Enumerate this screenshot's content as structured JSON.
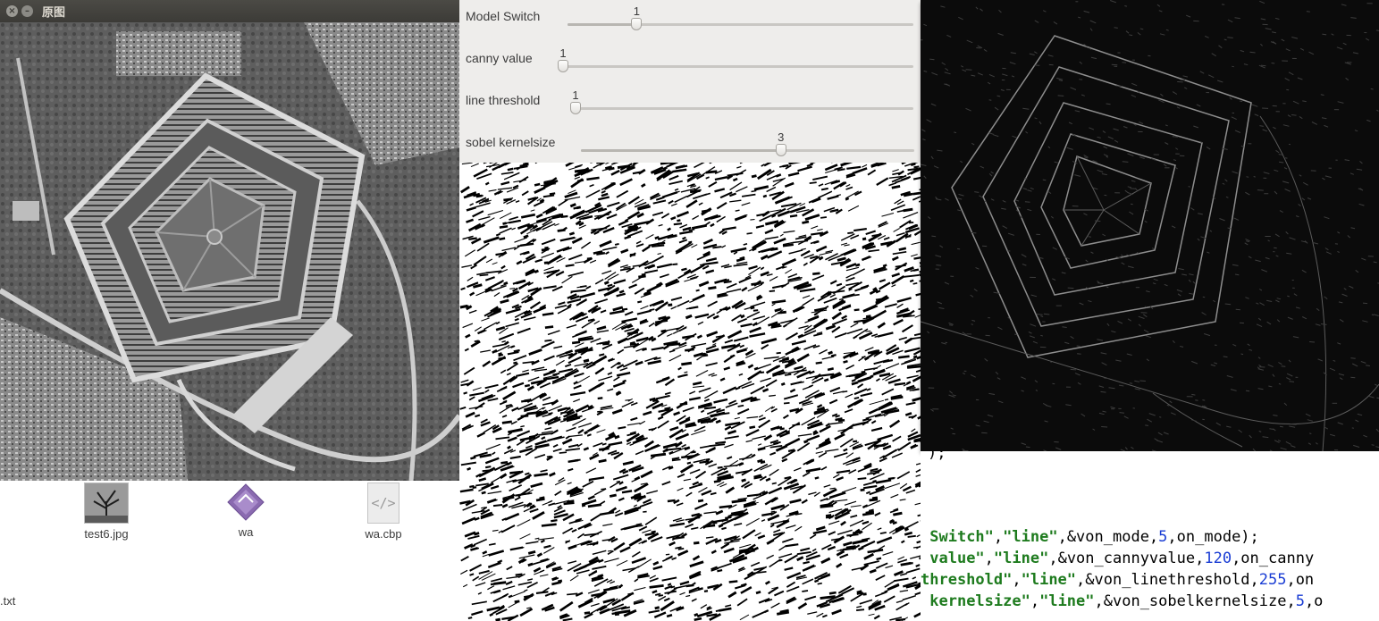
{
  "original_window": {
    "title": "原图",
    "close_glyph": "×",
    "minimize_glyph": "–",
    "image_icon": "aerial-photo-icon"
  },
  "trackbars": [
    {
      "label": "Model Switch",
      "value": "1",
      "fraction": 0.2
    },
    {
      "label": "canny value",
      "value": "1",
      "fraction": 0.0
    },
    {
      "label": "line threshold",
      "value": "1",
      "fraction": 0.0
    },
    {
      "label": "sobel kernelsize",
      "value": "3",
      "fraction": 0.6
    }
  ],
  "files": [
    {
      "name": "test6.jpg",
      "icon": "image-file-icon"
    },
    {
      "name": "wa",
      "icon": "executable-file-icon"
    },
    {
      "name": "wa.cbp",
      "icon": "code-file-icon",
      "glyph": "</>"
    }
  ],
  "stray_file": ".txt",
  "code": {
    "partial_line": ");",
    "lines": [
      {
        "prefix": " ",
        "s1": "Switch\"",
        "mid1": ",",
        "s2": "\"line\"",
        "mid2": ",&von_mode,",
        "num": "5",
        "tail": ",on_mode);"
      },
      {
        "prefix": " ",
        "s1": "value\"",
        "mid1": ",",
        "s2": "\"line\"",
        "mid2": ",&von_cannyvalue,",
        "num": "120",
        "tail": ",on_canny"
      },
      {
        "prefix": "",
        "s1": "threshold\"",
        "mid1": ",",
        "s2": "\"line\"",
        "mid2": ",&von_linethreshold,",
        "num": "255",
        "tail": ",on"
      },
      {
        "prefix": " ",
        "s1": "kernelsize\"",
        "mid1": ",",
        "s2": "\"line\"",
        "mid2": ",&von_sobelkernelsize,",
        "num": "5",
        "tail": ",o"
      }
    ]
  },
  "colors": {
    "titlebar": "#3c3b37",
    "panel": "#eeedeb",
    "code_string": "#1e7b1e",
    "code_number": "#1a3dd4"
  }
}
